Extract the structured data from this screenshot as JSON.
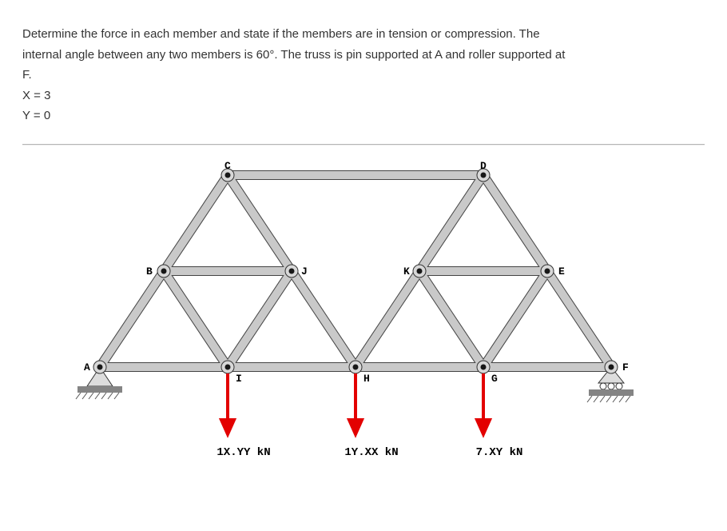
{
  "problem": {
    "line1": "Determine the force in each member and state if the members are in tension or compression. The",
    "line2": "internal angle between any two members is 60°. The truss is pin supported at A and roller supported at",
    "line3": "F.",
    "x_eq": "X = 3",
    "y_eq": "Y = 0"
  },
  "nodes": {
    "A": "A",
    "B": "B",
    "C": "C",
    "D": "D",
    "E": "E",
    "F": "F",
    "G": "G",
    "H": "H",
    "I": "I",
    "J": "J",
    "K": "K"
  },
  "forces": {
    "I": "1X.YY kN",
    "H": "1Y.XX kN",
    "G": "7.XY kN"
  },
  "chart_data": {
    "type": "diagram",
    "support_A": "pin",
    "support_F": "roller",
    "internal_angle_deg": 60,
    "load_positions": [
      "I",
      "H",
      "G"
    ],
    "load_labels": [
      "1X.YY kN",
      "1Y.XX kN",
      "7.XY kN"
    ],
    "X": 3,
    "Y": 0
  }
}
